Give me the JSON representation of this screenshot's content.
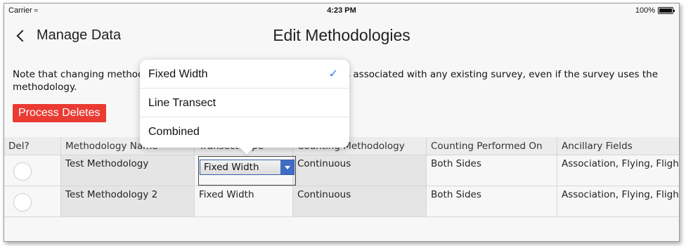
{
  "status_bar": {
    "carrier": "Carrier",
    "wifi_icon": "wifi-icon",
    "time": "4:23 PM",
    "battery": "100%"
  },
  "nav": {
    "back_label": "Manage Data",
    "title": "Edit Methodologies"
  },
  "note": "Note that changing methodology fields may change the ancillary fields associated with any existing survey, even if the survey uses the methodology.",
  "process_button": "Process Deletes",
  "table": {
    "headers": [
      "Del?",
      "Methodology Name",
      "Transect Type",
      "Counting Methodology",
      "Counting Performed On",
      "Ancillary Fields"
    ],
    "rows": [
      {
        "name": "Test Methodology",
        "transect": "Fixed Width",
        "counting": "Continuous",
        "performed_on": "Both Sides",
        "ancillary": "Association, Flying, Fligh"
      },
      {
        "name": "Test Methodology 2",
        "transect": "Fixed Width",
        "counting": "Continuous",
        "performed_on": "Both Sides",
        "ancillary": "Association, Flying, Fligh"
      }
    ]
  },
  "dropdown": {
    "options": [
      "Fixed Width",
      "Line Transect",
      "Combined"
    ],
    "selected": "Fixed Width"
  },
  "colors": {
    "accent": "#2f7af5",
    "danger": "#ea3b33",
    "select_blue": "#3f6cc4"
  }
}
